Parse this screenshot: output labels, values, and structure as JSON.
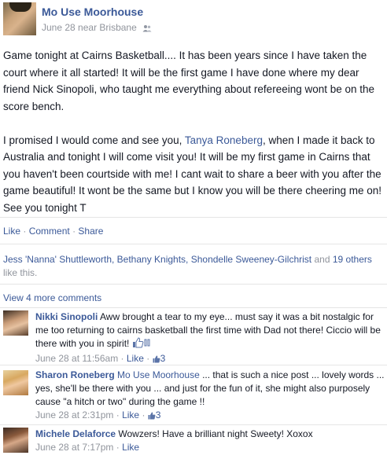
{
  "post": {
    "author": "Mo Use Moorhouse",
    "date": "June 28",
    "location_prefix": "near",
    "location": "Brisbane",
    "paragraph1": "Game tonight at Cairns Basketball.... It has been years since I have taken the court where it all started! It will be the first game I have done where my dear friend Nick Sinopoli, who taught me everything about refereeing wont be on the score bench.",
    "paragraph2_before": "I promised I would come and see you, ",
    "paragraph2_tag": "Tanya Roneberg",
    "paragraph2_after": ", when I made it back to Australia and tonight I will come visit you! It will be my first game in Cairns that you haven't been courtside with me! I cant wait to share a beer with you after the game beautiful! It wont be the same but I know you will be there cheering me on! See you tonight T"
  },
  "actions": {
    "like": "Like",
    "comment": "Comment",
    "share": "Share",
    "separator": "·"
  },
  "likes": {
    "names": "Jess 'Nanna' Shuttleworth, Bethany Knights, Shondelle Sweeney-Gilchrist",
    "and": " and ",
    "others": "19 others",
    "suffix": " like this."
  },
  "view_more": "View 4 more comments",
  "comments": [
    {
      "name": "Nikki Sinopoli",
      "text": " Aww brought a tear to my eye... must say it was a bit nostalgic for me too returning to cairns basketball the first time with Dad not there! Ciccio will be there with you in spirit!",
      "time": "June 28 at 11:56am",
      "like": "Like",
      "count": "3"
    },
    {
      "name": "Sharon Roneberg",
      "tag": "Mo Use Moorhouse",
      "text": " ... that is such a nice post ... lovely words ... yes, she'll be there with you ... and just for the fun of it, she might also purposely cause \"a hitch or two\" during the game !!",
      "time": "June 28 at 2:31pm",
      "like": "Like",
      "count": "3"
    },
    {
      "name": "Michele Delaforce",
      "text": " Wowzers! Have a brilliant night Sweety! Xoxox",
      "time": "June 28 at 7:17pm",
      "like": "Like"
    }
  ],
  "colors": {
    "link": "#3b5998",
    "meta": "#90949c",
    "text": "#141823",
    "divider": "#e5e5e5"
  },
  "icons": [
    "friends-icon",
    "thumbs-up-icon",
    "like-count-icon"
  ]
}
